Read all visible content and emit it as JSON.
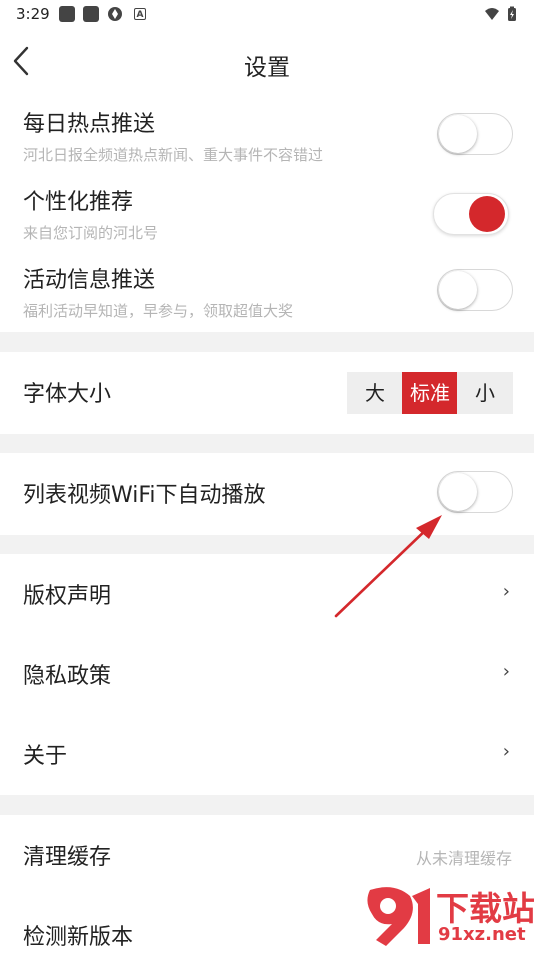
{
  "status_bar": {
    "time": "3:29"
  },
  "header": {
    "title": "设置"
  },
  "notifications": [
    {
      "title": "每日热点推送",
      "subtitle": "河北日报全频道热点新闻、重大事件不容错过",
      "enabled": false
    },
    {
      "title": "个性化推荐",
      "subtitle": "来自您订阅的河北号",
      "enabled": true
    },
    {
      "title": "活动信息推送",
      "subtitle": "福利活动早知道，早参与，领取超值大奖",
      "enabled": false
    }
  ],
  "font_size": {
    "label": "字体大小",
    "options": [
      "大",
      "标准",
      "小"
    ],
    "selected": "标准"
  },
  "video_autoplay": {
    "label": "列表视频WiFi下自动播放",
    "enabled": false
  },
  "info_links": [
    {
      "label": "版权声明",
      "chevron": "›"
    },
    {
      "label": "隐私政策",
      "chevron": "›"
    },
    {
      "label": "关于",
      "chevron": "›"
    }
  ],
  "cache": {
    "label": "清理缓存",
    "value": "从未清理缓存"
  },
  "update": {
    "label": "检测新版本"
  },
  "watermark": {
    "text": "下载站",
    "url_text": "91xz.net"
  },
  "colors": {
    "accent": "#d4282c",
    "separator": "#f2f2f2",
    "subtitle": "#b5b5b5"
  }
}
